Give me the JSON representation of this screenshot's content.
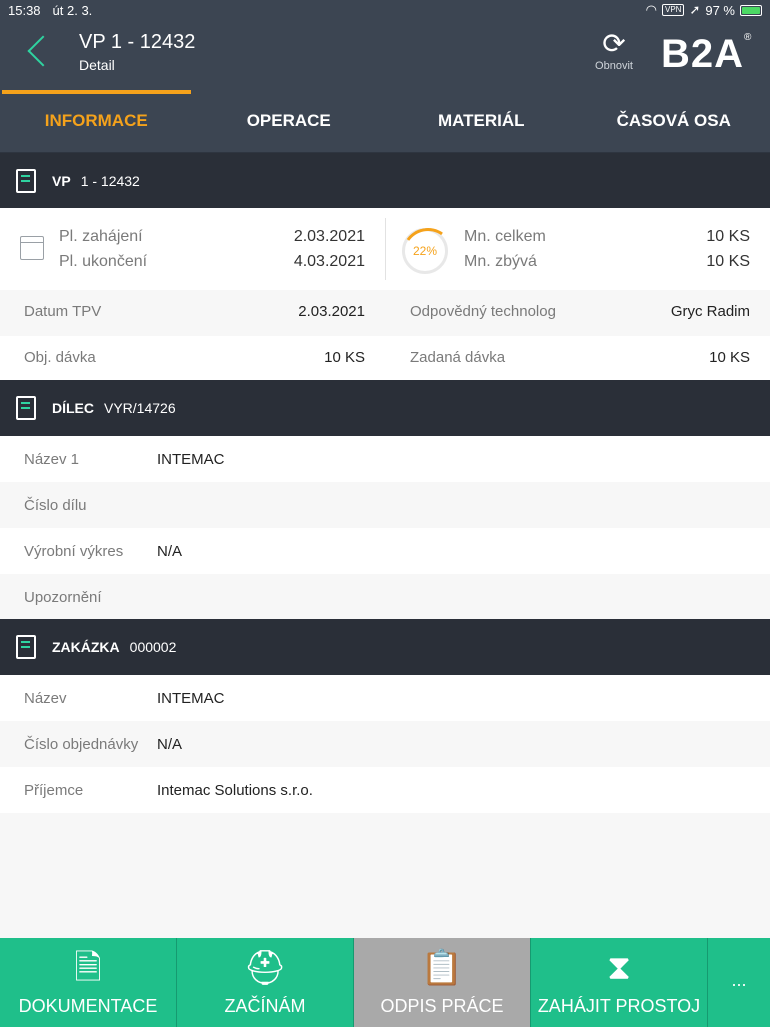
{
  "status": {
    "time": "15:38",
    "date": "út 2. 3.",
    "vpn": "VPN",
    "battery": "97 %"
  },
  "header": {
    "title": "VP 1 - 12432",
    "subtitle": "Detail",
    "refresh_label": "Obnovit",
    "logo": "B2A",
    "logo_mark": "®"
  },
  "tabs": [
    {
      "label": "INFORMACE",
      "active": true
    },
    {
      "label": "OPERACE"
    },
    {
      "label": "MATERIÁL"
    },
    {
      "label": "ČASOVÁ OSA"
    }
  ],
  "vp": {
    "key": "VP",
    "value": "1 - 12432",
    "start_label": "Pl. zahájení",
    "start": "2.03.2021",
    "end_label": "Pl. ukončení",
    "end": "4.03.2021",
    "progress": "22%",
    "total_label": "Mn. celkem",
    "total": "10 KS",
    "remain_label": "Mn. zbývá",
    "remain": "10 KS",
    "tpv_label": "Datum TPV",
    "tpv": "2.03.2021",
    "tech_label": "Odpovědný technolog",
    "tech": "Gryc Radim",
    "obj_label": "Obj. dávka",
    "obj": "10 KS",
    "zad_label": "Zadaná dávka",
    "zad": "10 KS"
  },
  "dilec": {
    "key": "DÍLEC",
    "value": "VYR/14726",
    "rows": [
      {
        "label": "Název 1",
        "value": "INTEMAC"
      },
      {
        "label": "Číslo dílu",
        "value": ""
      },
      {
        "label": "Výrobní výkres",
        "value": "N/A"
      },
      {
        "label": "Upozornění",
        "value": ""
      }
    ]
  },
  "zakazka": {
    "key": "ZAKÁZKA",
    "value": "000002",
    "rows": [
      {
        "label": "Název",
        "value": "INTEMAC"
      },
      {
        "label": "Číslo objednávky",
        "value": "N/A"
      },
      {
        "label": "Příjemce",
        "value": "Intemac Solutions s.r.o."
      }
    ]
  },
  "bottom": [
    {
      "label": "DOKUMENTACE",
      "icon": "document-gear-icon"
    },
    {
      "label": "ZAČÍNÁM",
      "icon": "hard-hat-icon"
    },
    {
      "label": "ODPIS PRÁCE",
      "icon": "clipboard-check-icon"
    },
    {
      "label": "ZAHÁJIT PROSTOJ",
      "icon": "hourglass-icon"
    },
    {
      "label": "...",
      "icon": "more-icon"
    }
  ],
  "colors": {
    "header": "#3c4552",
    "accent": "#f5a21b",
    "green": "#1fbf8a",
    "section": "#2a2f38"
  }
}
